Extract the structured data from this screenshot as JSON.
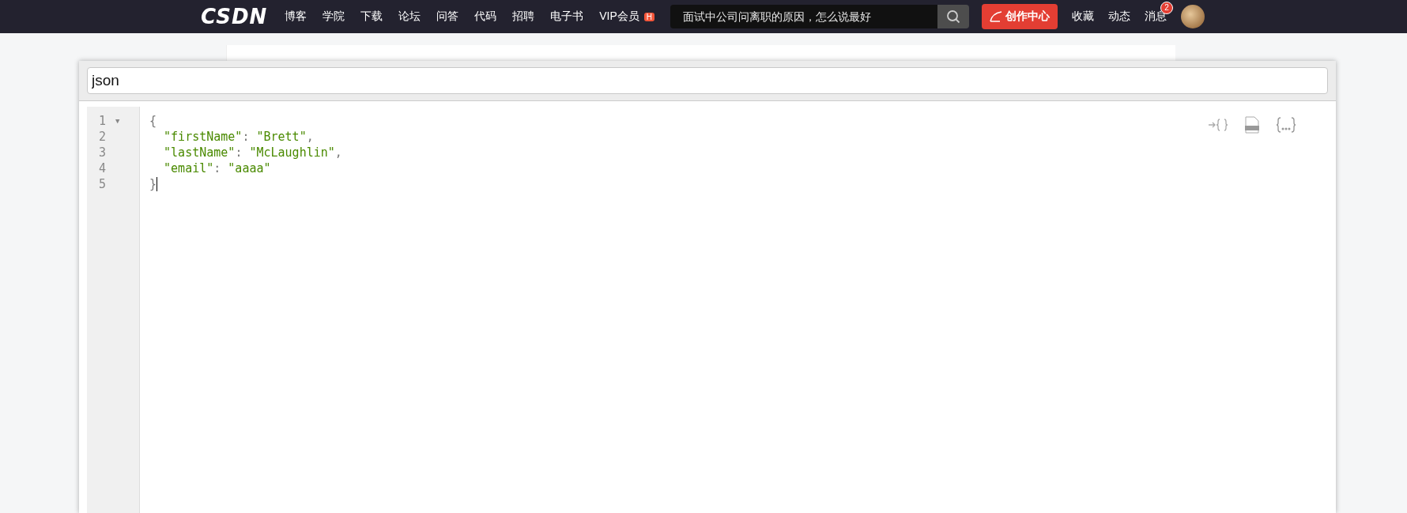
{
  "header": {
    "logo": "CSDN",
    "nav": [
      {
        "label": "博客"
      },
      {
        "label": "学院"
      },
      {
        "label": "下载"
      },
      {
        "label": "论坛"
      },
      {
        "label": "问答"
      },
      {
        "label": "代码"
      },
      {
        "label": "招聘"
      },
      {
        "label": "电子书"
      },
      {
        "label": "VIP会员",
        "badge": "H"
      }
    ],
    "search": {
      "placeholder": "面试中公司问离职的原因，怎么说最好"
    },
    "create_button": "创作中心",
    "links": [
      {
        "label": "收藏"
      },
      {
        "label": "动态"
      },
      {
        "label": "消息",
        "badge": "2"
      }
    ]
  },
  "dialog": {
    "title_field": {
      "value": "json"
    },
    "editor": {
      "lines": [
        {
          "number": "1",
          "text": "{",
          "fold": "▼",
          "cursor": false
        },
        {
          "number": "2",
          "text": "  \"firstName\": \"Brett\",",
          "cursor": false
        },
        {
          "number": "3",
          "text": "  \"lastName\": \"McLaughlin\",",
          "cursor": false
        },
        {
          "number": "4",
          "text": "  \"email\": \"aaaa\"",
          "cursor": false
        },
        {
          "number": "5",
          "text": "}",
          "cursor": true
        }
      ],
      "tools": [
        {
          "kind": "compact"
        },
        {
          "kind": "file"
        },
        {
          "kind": "format"
        }
      ]
    }
  }
}
